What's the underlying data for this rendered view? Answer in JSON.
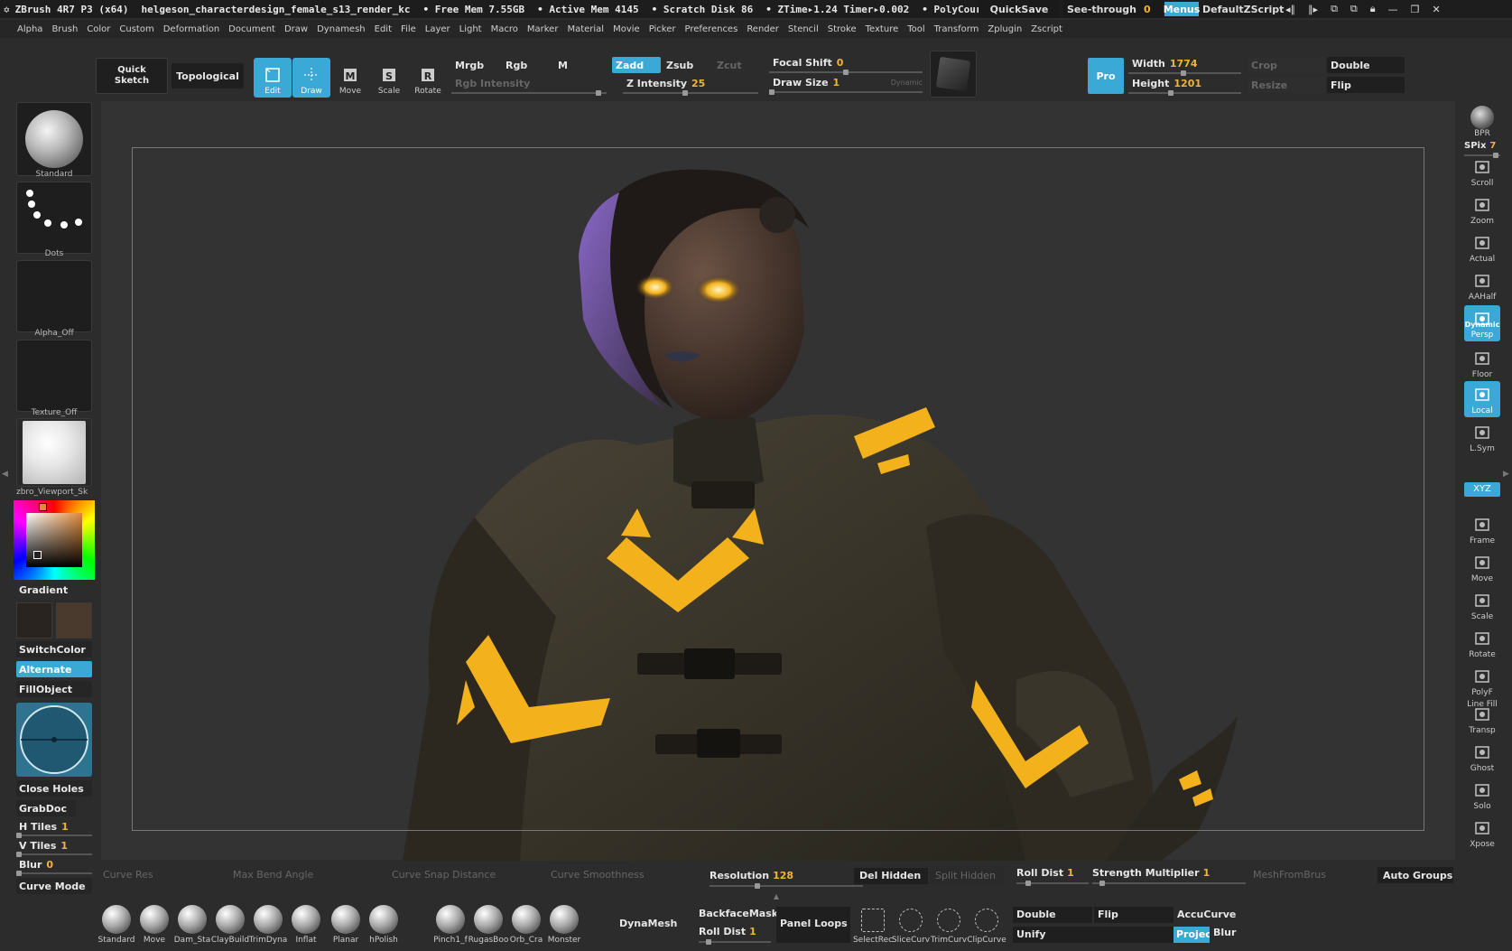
{
  "titlebar": {
    "app": "ZBrush 4R7 P3 (x64)",
    "document": "helgeson_characterdesign_female_s13_render_kc",
    "free_mem": "• Free Mem 7.55GB",
    "active_mem": "• Active Mem 4145",
    "scratch": "• Scratch Disk 86",
    "ztime": "• ZTime▸1.24 Timer▸0.002",
    "polycount": "• PolyCour",
    "quicksave": "QuickSave",
    "seethrough": "See-through",
    "seethrough_val": "0",
    "menus": "Menus",
    "script": "DefaultZScript"
  },
  "menubar": [
    "Alpha",
    "Brush",
    "Color",
    "Custom",
    "Deformation",
    "Document",
    "Draw",
    "Dynamesh",
    "Edit",
    "File",
    "Layer",
    "Light",
    "Macro",
    "Marker",
    "Material",
    "Movie",
    "Picker",
    "Preferences",
    "Render",
    "Stencil",
    "Stroke",
    "Texture",
    "Tool",
    "Transform",
    "Zplugin",
    "Zscript"
  ],
  "shelf": {
    "quick_sketch_1": "Quick",
    "quick_sketch_2": "Sketch",
    "topological": "Topological",
    "tools": [
      {
        "label": "Edit",
        "icon": "edit-icon"
      },
      {
        "label": "Draw",
        "icon": "draw-icon"
      },
      {
        "label": "Move",
        "icon": "move-icon"
      },
      {
        "label": "Scale",
        "icon": "scale-icon"
      },
      {
        "label": "Rotate",
        "icon": "rotate-icon"
      }
    ],
    "mrgb": "Mrgb",
    "rgb": "Rgb",
    "m": "M",
    "rgb_intensity": "Rgb Intensity",
    "zadd": "Zadd",
    "zsub": "Zsub",
    "zcut": "Zcut",
    "z_intensity": "Z Intensity",
    "z_intensity_val": "25",
    "focal_shift": "Focal Shift",
    "focal_shift_val": "0",
    "draw_size": "Draw Size",
    "draw_size_val": "1",
    "dynamic": "Dynamic",
    "pro": "Pro",
    "width": "Width",
    "width_val": "1774",
    "height": "Height",
    "height_val": "1201",
    "crop": "Crop",
    "resize": "Resize",
    "double": "Double",
    "flip": "Flip"
  },
  "left": {
    "brush_label": "Standard",
    "stroke_label": "Dots",
    "alpha_label": "Alpha_Off",
    "texture_label": "Texture_Off",
    "material_label": "zbro_Viewport_Sk",
    "gradient": "Gradient",
    "switchcolor": "SwitchColor",
    "alternate": "Alternate",
    "fillobject": "FillObject",
    "close_holes": "Close Holes",
    "grabdoc": "GrabDoc",
    "h_tiles": "H Tiles",
    "h_tiles_val": "1",
    "v_tiles": "V Tiles",
    "v_tiles_val": "1",
    "blur": "Blur",
    "blur_val": "0",
    "curve_mode": "Curve Mode"
  },
  "right": {
    "bpr": "BPR",
    "spix": "SPix",
    "spix_val": "7",
    "tools": [
      {
        "label": "Scroll",
        "icon": "scroll-icon",
        "active": false
      },
      {
        "label": "Zoom",
        "icon": "zoom-icon",
        "active": false
      },
      {
        "label": "Actual",
        "icon": "actual-icon",
        "active": false
      },
      {
        "label": "AAHalf",
        "icon": "aahalf-icon",
        "active": false
      },
      {
        "label": "Persp",
        "icon": "persp-icon",
        "active": true
      },
      {
        "label": "Floor",
        "icon": "floor-icon",
        "active": false
      },
      {
        "label": "Local",
        "icon": "local-icon",
        "active": true
      },
      {
        "label": "L.Sym",
        "icon": "lsym-icon",
        "active": false
      },
      {
        "label": "Frame",
        "icon": "frame-icon",
        "active": false
      },
      {
        "label": "Move",
        "icon": "move-icon",
        "active": false
      },
      {
        "label": "Scale",
        "icon": "scale-icon",
        "active": false
      },
      {
        "label": "Rotate",
        "icon": "rotate-icon",
        "active": false
      },
      {
        "label": "PolyF",
        "icon": "polyf-icon",
        "active": false
      },
      {
        "label": "Transp",
        "icon": "transp-icon",
        "active": false
      },
      {
        "label": "Ghost",
        "icon": "ghost-icon",
        "active": false
      },
      {
        "label": "Solo",
        "icon": "solo-icon",
        "active": false
      },
      {
        "label": "Xpose",
        "icon": "xpose-icon",
        "active": false
      }
    ],
    "dynamic": "Dynamic",
    "xyz": "XYZ",
    "line_fill": "Line Fill"
  },
  "bottom1": {
    "curve_res": "Curve Res",
    "max_bend": "Max Bend Angle",
    "snap_dist": "Curve Snap Distance",
    "smoothness": "Curve Smoothness",
    "resolution": "Resolution",
    "resolution_val": "128",
    "del_hidden": "Del Hidden",
    "split_hidden": "Split Hidden",
    "roll_dist": "Roll Dist",
    "roll_dist_val": "1",
    "strength_mult": "Strength Multiplier",
    "strength_mult_val": "1",
    "meshfrombrush": "MeshFromBrus",
    "auto_groups": "Auto Groups"
  },
  "bottom2": {
    "brushes": [
      "Standard",
      "Move",
      "Dam_Sta",
      "ClayBuild",
      "TrimDyna",
      "Inflat",
      "Planar",
      "hPolish",
      "Pinch1_f",
      "RugasBoo",
      "Orb_Cra",
      "Monster"
    ],
    "dynamesh": "DynaMesh",
    "backfacemask": "BackfaceMask",
    "roll_dist": "Roll Dist",
    "roll_dist_val": "1",
    "panel_loops": "Panel Loops",
    "curve_tools": [
      "SelectRec",
      "SliceCurv",
      "TrimCurv",
      "ClipCurve"
    ],
    "double": "Double",
    "flip": "Flip",
    "accucurve": "AccuCurve",
    "unify": "Unify",
    "projec": "Projec",
    "blur": "Blur"
  },
  "colors": {
    "accent": "#3aa9d6",
    "value": "#f0b43c",
    "glow": "#f3b21c"
  }
}
